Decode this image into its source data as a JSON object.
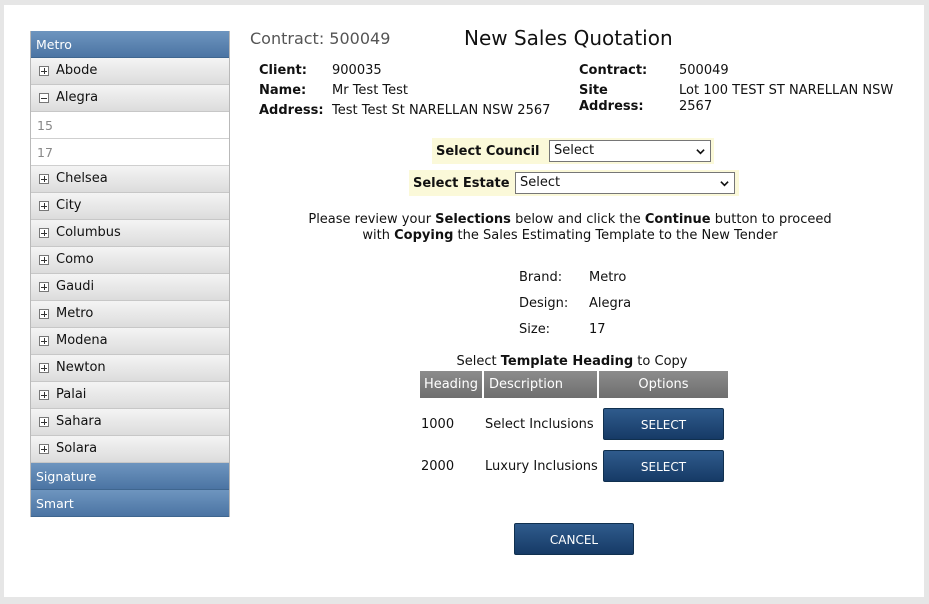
{
  "sidebar": {
    "brands": [
      {
        "label": "Metro"
      },
      {
        "label": "Signature"
      },
      {
        "label": "Smart"
      }
    ],
    "designs": [
      {
        "label": "Abode",
        "expanded": false
      },
      {
        "label": "Alegra",
        "expanded": true,
        "sizes": [
          "15",
          "17"
        ]
      },
      {
        "label": "Chelsea",
        "expanded": false
      },
      {
        "label": "City",
        "expanded": false
      },
      {
        "label": "Columbus",
        "expanded": false
      },
      {
        "label": "Como",
        "expanded": false
      },
      {
        "label": "Gaudi",
        "expanded": false
      },
      {
        "label": "Metro",
        "expanded": false
      },
      {
        "label": "Modena",
        "expanded": false
      },
      {
        "label": "Newton",
        "expanded": false
      },
      {
        "label": "Palai",
        "expanded": false
      },
      {
        "label": "Sahara",
        "expanded": false
      },
      {
        "label": "Solara",
        "expanded": false
      }
    ]
  },
  "header": {
    "contract_title": "Contract: 500049",
    "page_title": "New Sales Quotation"
  },
  "info_left": {
    "client_label": "Client:",
    "client_value": "900035",
    "name_label": "Name:",
    "name_value": "Mr Test Test",
    "address_label": "Address:",
    "address_value": "Test Test St NARELLAN NSW 2567"
  },
  "info_right": {
    "contract_label": "Contract:",
    "contract_value": "500049",
    "site_label_1": "Site",
    "site_label_2": "Address:",
    "site_value_1": "Lot 100 TEST ST NARELLAN NSW",
    "site_value_2": "2567"
  },
  "selectors": {
    "council_label": "Select Council",
    "council_value": "Select",
    "estate_label": "Select Estate",
    "estate_value": "Select"
  },
  "instruction": {
    "p1": "Please review your ",
    "b1": "Selections",
    "p2": " below and click the ",
    "b2": "Continue",
    "p3": " button to proceed",
    "p4": "with ",
    "b3": "Copying",
    "p5": " the Sales Estimating Template to the New Tender"
  },
  "summary": {
    "brand_label": "Brand:",
    "brand_value": "Metro",
    "design_label": "Design:",
    "design_value": "Alegra",
    "size_label": "Size:",
    "size_value": "17"
  },
  "template": {
    "title_pre": "Select ",
    "title_bold": "Template Heading",
    "title_post": " to Copy",
    "columns": [
      "Heading",
      "Description",
      "Options"
    ],
    "rows": [
      {
        "heading": "1000",
        "description": "Select Inclusions",
        "button": "SELECT"
      },
      {
        "heading": "2000",
        "description": "Luxury Inclusions",
        "button": "SELECT"
      }
    ]
  },
  "cancel_label": "CANCEL",
  "colors": {
    "brand_bar": "#5a82b0",
    "button": "#1f4677",
    "highlight": "#fbf9d9",
    "table_header": "#7d7d7d"
  }
}
